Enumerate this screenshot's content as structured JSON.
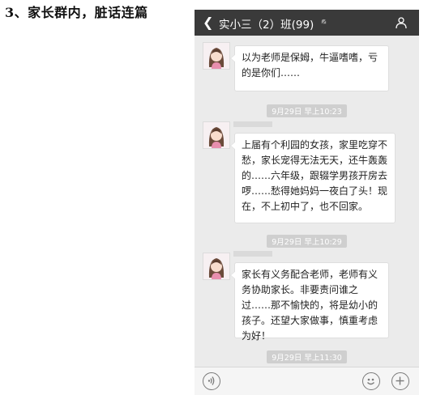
{
  "caption": "3、家长群内，脏话连篇",
  "chat": {
    "title": "实小三（2）班(99)",
    "messages": [
      {
        "text": "以为老师是保姆，牛逼嗜嗜，亏的是你们……"
      },
      {
        "timestamp": "9月29日 早上10:23"
      },
      {
        "text": "上届有个利园的女孩，家里吃穿不愁，家长宠得无法无天，还牛轰轰的……六年级，跟辍学男孩开房去啰……愁得她妈妈一夜白了头！现在，不上初中了，也不回家。"
      },
      {
        "timestamp": "9月29日 早上10:29"
      },
      {
        "text": "家长有义务配合老师，老师有义务协助家长。非要责问谁之过……那不愉快的，将是幼小的孩子。还望大家做事，慎重考虑为好！"
      },
      {
        "timestamp": "9月29日 早上11:30"
      }
    ]
  },
  "icons": {
    "back": "chevron-left-icon",
    "mute": "mute-bell-icon",
    "group": "group-people-icon",
    "voice": "voice-input-icon",
    "emoji": "emoji-icon",
    "plus": "plus-icon"
  }
}
